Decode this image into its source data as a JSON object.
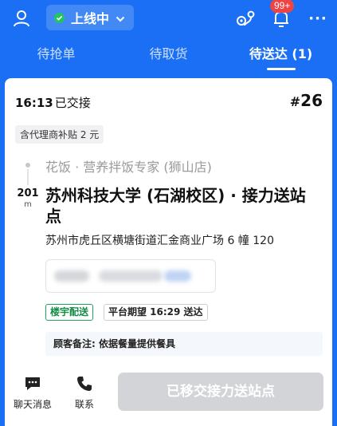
{
  "header": {
    "status_label": "上线中",
    "notification_count": "99+",
    "more_label": "···"
  },
  "tabs": [
    {
      "label": "待抢单"
    },
    {
      "label": "待取货"
    },
    {
      "label": "待送达 (1)"
    }
  ],
  "order": {
    "time": "16:13",
    "time_status": "已交接",
    "number_hash": "#",
    "number": "26",
    "subsidy_tag": "含代理商补贴 2 元",
    "store_name": "花饭 · 营养拌饭专家 (狮山店)",
    "distance_value": "201",
    "distance_unit": "m",
    "destination_name": "苏州科技大学 (石湖校区) · 接力送站点",
    "destination_address": "苏州市虎丘区横塘街道汇金商业广场 6 幢 120",
    "tags": [
      {
        "label": "楼宇配送"
      },
      {
        "label": "平台期望 16:29 送达"
      }
    ],
    "remark": "顾客备注: 依据餐量提供餐具"
  },
  "actions": {
    "chat_label": "聊天消息",
    "call_label": "联系",
    "relay_label": "已移交接力送站点"
  },
  "colors": {
    "brand_blue": "#1a6ff5",
    "online_green": "#22c55e",
    "badge_red": "#ef4444",
    "disabled_button": "#d2d4d8"
  }
}
